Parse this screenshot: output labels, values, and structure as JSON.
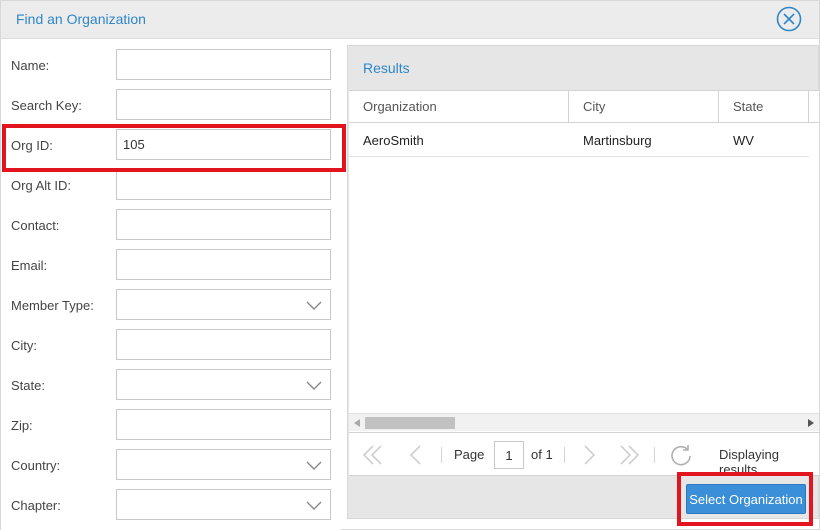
{
  "dialog": {
    "title": "Find an Organization"
  },
  "form": {
    "name_label": "Name:",
    "search_key_label": "Search Key:",
    "org_id_label": "Org ID:",
    "org_id_value": "105",
    "org_alt_id_label": "Org Alt ID:",
    "contact_label": "Contact:",
    "email_label": "Email:",
    "member_type_label": "Member Type:",
    "city_label": "City:",
    "state_label": "State:",
    "zip_label": "Zip:",
    "country_label": "Country:",
    "chapter_label": "Chapter:"
  },
  "results": {
    "title": "Results",
    "columns": [
      "Organization",
      "City",
      "State"
    ],
    "rows": [
      {
        "organization": "AeroSmith",
        "city": "Martinsburg",
        "state": "WV"
      }
    ]
  },
  "pager": {
    "page_label": "Page",
    "page_value": "1",
    "of_label": "of 1",
    "status": "Displaying results"
  },
  "actions": {
    "select_label": "Select Organization"
  },
  "colors": {
    "accent": "#2f86c9",
    "highlight": "#e1141f",
    "button": "#3a8fd8"
  }
}
